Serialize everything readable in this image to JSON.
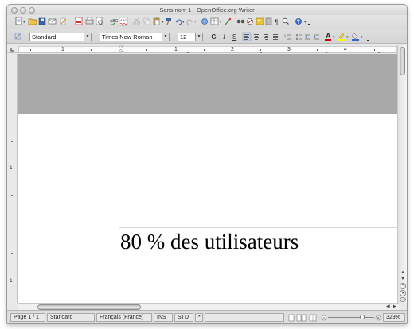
{
  "window": {
    "title": "Sans nom 1 - OpenOffice.org Writer"
  },
  "toolbar": {
    "style_value": "Standard",
    "font_value": "Times New Roman",
    "size_value": "12",
    "bold_label": "G",
    "italic_label": "I",
    "underline_label": "S",
    "icons": [
      "new-icon",
      "open-icon",
      "save-icon",
      "email-icon",
      "edit-file-icon",
      "pdf-icon",
      "print-icon",
      "print-preview-icon",
      "spellcheck-icon",
      "autospell-icon",
      "cut-icon",
      "copy-icon",
      "paste-icon",
      "format-paintbrush-icon",
      "undo-icon",
      "redo-icon",
      "hyperlink-icon",
      "table-icon",
      "draw-functions-icon",
      "find-replace-icon",
      "navigator-icon",
      "gallery-icon",
      "data-sources-icon",
      "nonprinting-chars-icon",
      "zoom-icon",
      "help-icon"
    ],
    "colors": {
      "font_color": "#cc0000",
      "highlight": "#ffff00",
      "background": "#3366cc"
    }
  },
  "ruler": {
    "labels": [
      "1",
      "1",
      "2",
      "3",
      "4"
    ]
  },
  "vruler": {
    "labels": [
      "1",
      "1"
    ]
  },
  "document": {
    "text": "80 % des utilisateurs"
  },
  "statusbar": {
    "page": "Page 1 / 1",
    "style": "Standard",
    "language": "Français (France)",
    "insert_mode": "INS",
    "selection_mode": "STD",
    "modified": "*",
    "zoom": "329%"
  }
}
